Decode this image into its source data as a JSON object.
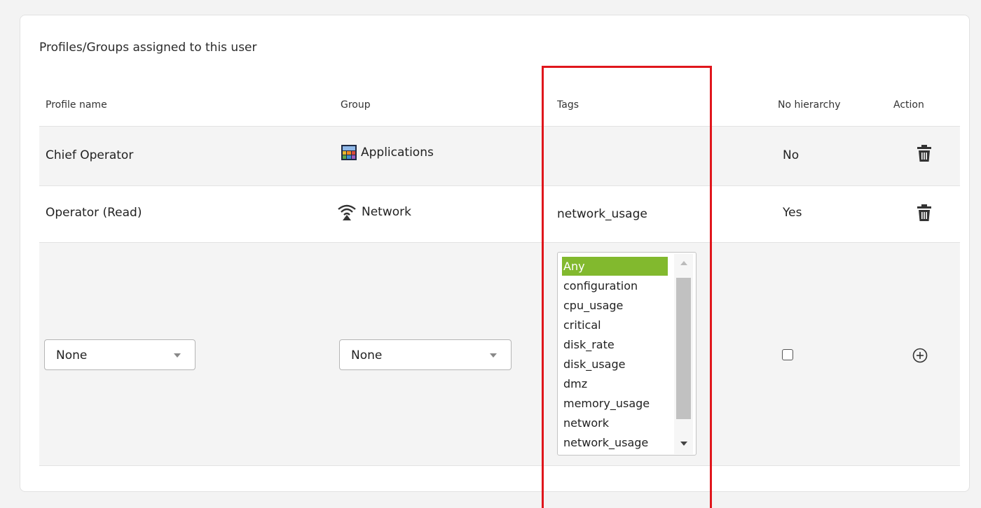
{
  "panel": {
    "title": "Profiles/Groups assigned to this user"
  },
  "columns": {
    "profile": "Profile name",
    "group": "Group",
    "tags": "Tags",
    "no_hierarchy": "No hierarchy",
    "action": "Action"
  },
  "rows": [
    {
      "profile": "Chief Operator",
      "group": "Applications",
      "group_icon": "applications-icon",
      "tags": "",
      "no_hierarchy": "No",
      "action_icon": "trash-icon"
    },
    {
      "profile": "Operator (Read)",
      "group": "Network",
      "group_icon": "network-icon",
      "tags": "network_usage",
      "no_hierarchy": "Yes",
      "action_icon": "trash-icon"
    }
  ],
  "new_row": {
    "profile_select": "None",
    "group_select": "None",
    "tag_options": [
      "Any",
      "configuration",
      "cpu_usage",
      "critical",
      "disk_rate",
      "disk_usage",
      "dmz",
      "memory_usage",
      "network",
      "network_usage"
    ],
    "selected_tag": "Any",
    "no_hierarchy_checked": false,
    "action_icon": "add-circle-icon"
  },
  "colors": {
    "selected_option": "#82b92e",
    "highlight_box": "#e0161c",
    "row_bg": "#f4f4f4"
  }
}
